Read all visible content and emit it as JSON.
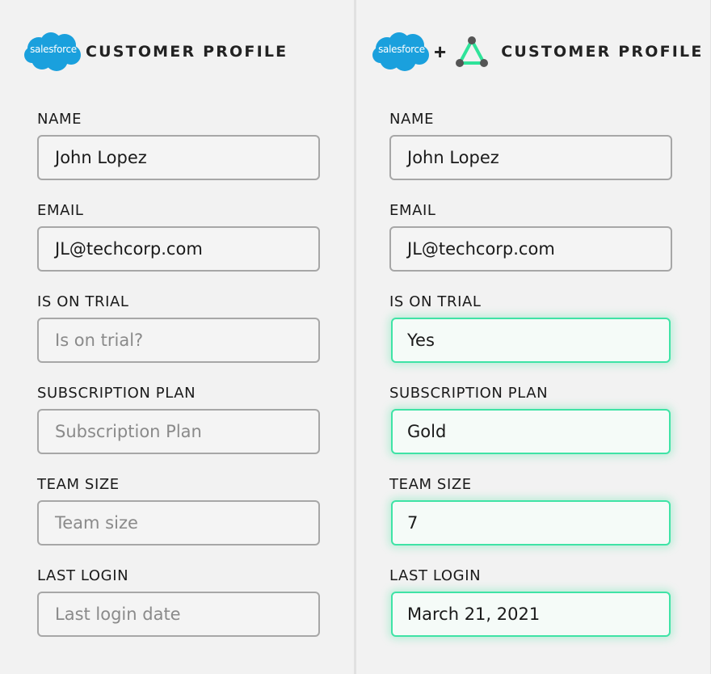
{
  "left_panel": {
    "logo_text": "salesforce",
    "title": "CUSTOMER PROFILE",
    "fields": [
      {
        "label": "NAME",
        "value": "John Lopez"
      },
      {
        "label": "EMAIL",
        "value": "JL@techcorp.com"
      },
      {
        "label": "IS ON TRIAL",
        "placeholder": "Is on trial?"
      },
      {
        "label": "SUBSCRIPTION PLAN",
        "placeholder": "Subscription Plan"
      },
      {
        "label": "TEAM SIZE",
        "placeholder": "Team size"
      },
      {
        "label": "LAST LOGIN",
        "placeholder": "Last login date"
      }
    ]
  },
  "right_panel": {
    "logo_text": "salesforce",
    "plus": "+",
    "title": "CUSTOMER PROFILE",
    "fields": [
      {
        "label": "NAME",
        "value": "John Lopez"
      },
      {
        "label": "EMAIL",
        "value": "JL@techcorp.com"
      },
      {
        "label": "IS ON TRIAL",
        "value": "Yes"
      },
      {
        "label": "SUBSCRIPTION PLAN",
        "value": "Gold"
      },
      {
        "label": "TEAM SIZE",
        "value": "7"
      },
      {
        "label": "LAST LOGIN",
        "value": "March 21, 2021"
      }
    ]
  },
  "colors": {
    "salesforce_blue": "#1aa0dd",
    "highlight_green": "#3fe3a6",
    "border_gray": "#a7a7a7",
    "placeholder_gray": "#8a8a8a"
  },
  "icons": [
    "salesforce-logo-icon",
    "triangle-nodes-logo-icon"
  ]
}
